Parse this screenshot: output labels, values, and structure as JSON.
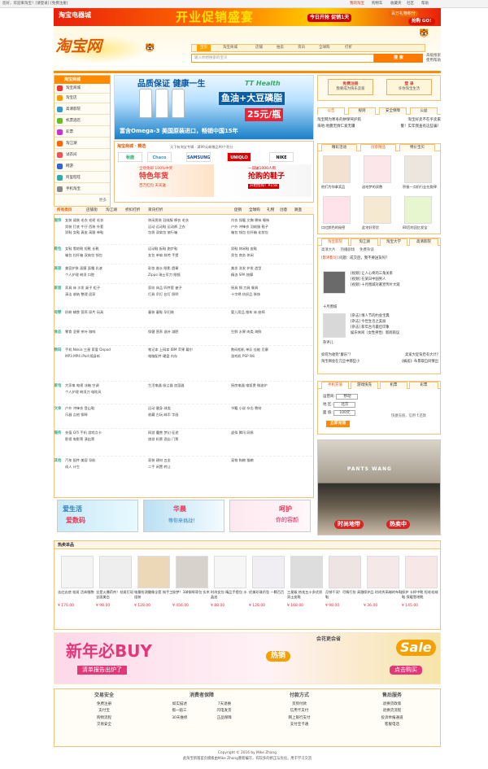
{
  "topbar": {
    "welcome": "您好，欢迎来淘宝！[请登录] [免费注册]",
    "links": [
      "我的淘宝",
      "购物车",
      "收藏夹",
      "社区",
      "帮助"
    ]
  },
  "topbanner": {
    "store": "淘宝电器城",
    "headline": "开业促销盛宴",
    "today": "今日开抢  促销1天",
    "bonus": "百万礼物积分",
    "cta": "抢购 GO!"
  },
  "logo": "淘宝网",
  "nav": {
    "tabs": [
      "宝贝",
      "淘宝商城",
      "店铺",
      "拍卖",
      "资讯",
      "全球购",
      "打折"
    ],
    "search_placeholder": "输入你想搜索的宝贝",
    "search_button": "搜 索",
    "links": [
      "高级搜索",
      "使用帮助"
    ]
  },
  "left_menu": {
    "header": "淘宝商城",
    "items": [
      "淘宝商城",
      "淘宝店",
      "高清影院",
      "机票酒店",
      "彩票",
      "淘江湖",
      "试衣间",
      "网游",
      "阿里旺旺",
      "手机淘宝"
    ],
    "more": "更多"
  },
  "banner": {
    "title": "品质保证 健康一生",
    "brand": "TT Health",
    "product": "鱼油+大豆磷脂",
    "price_label": "25元/瓶",
    "footer": "富含Omega-3 美国原装进口，畅销中国15年"
  },
  "mall": {
    "title": "淘宝商城 · 精选",
    "tip": "天下有淘宝专辑 · 满99元邮赠品99个积分",
    "brands": [
      "Chaco",
      "秋鹿",
      "SAMSUNG",
      "UNIQLO",
      "NIKE"
    ],
    "promo1": {
      "a": "全场免邮 100%中奖",
      "b": "特色年货",
      "c": "百万红包 天天送"
    },
    "promo2": {
      "a": "一双破1000人购",
      "b": "抢购的鞋子",
      "c": "开始抢购！¥158"
    }
  },
  "services": {
    "btn1": "免费注册",
    "btn1_sub": "我要成为快乐卖家",
    "btn2": "登 录",
    "btn2_sub": "许你淘宝生活"
  },
  "news_tabs": [
    "公告",
    "规则",
    "安全保障",
    "公益"
  ],
  "news": [
    "淘宝网为寒冬的拼保驾护航",
    "淘宝好卖不在乎卖家",
    "海地:地震无情仁爱无疆",
    "警！实年我查有这些骗！"
  ],
  "featured": {
    "tabs": [
      "精彩活动",
      "创意精品",
      "特价宝贝"
    ],
    "items": [
      {
        "cap": "他们为你拿奖品"
      },
      {
        "cap": "送给梦的双胞"
      },
      {
        "cap": "积极一点机行业在旋律"
      },
      {
        "cap": "口红颜色的秘密"
      },
      {
        "cap": "此宅好旁货"
      },
      {
        "cap": "80后的回忆发宝"
      }
    ]
  },
  "community": {
    "tabs": [
      "淘宝影院",
      "淘江湖",
      "淘宝大学",
      "高清影院"
    ],
    "tags": [
      "高清大片",
      "热播剧场",
      "免费杂谈"
    ],
    "hot": "[影评影论]",
    "items": [
      "问题：成交后，我不要送货吗？",
      "[视频] 让人心疼的三角关系",
      "[视频] 在某日中国男人",
      "[视频] 十月围城对著宣传片大观",
      "十月围城",
      "[杂志] 情人节的约会宝典",
      "[杂志] 今世生百之美丽",
      "[杂志] 新年台鸟最佳印象",
      "娱乐休闲（女性男性）新闻商议",
      "杂评儿"
    ],
    "questions": [
      "如何为收到\"康乐\"?",
      "卖家大促背后有大计?",
      "淘宝网会在元旦中哪些小",
      "《蜗居》布景取自同情出"
    ]
  },
  "phone": {
    "tabs": [
      "手机充值",
      "游戏快充",
      "机票",
      "彩票"
    ],
    "carrier_label": "运营商:",
    "carrier": "移动",
    "area_label": "地 区:",
    "area": "北京",
    "amount_label": "面 值:",
    "amount": "100元",
    "button": "立即充值",
    "tip": "快捷充值，信用卡还款"
  },
  "categories": {
    "header_tabs": [
      "所有类目",
      "店铺街",
      "淘江湖",
      "折扣打折",
      "资讯打折"
    ],
    "right_tabs": [
      "促销",
      "全球购",
      "礼物",
      "创意",
      "跳蚤"
    ],
    "rows": [
      {
        "label": "服饰",
        "cols": [
          "女装 裙装 毛衣 毛呢 毛衣",
          "休闲男装 羽绒服 棉衣 毛衣",
          "内衣 保暖 文胸 棉袜 睡袜",
          "男装 打底 牛仔 西装 外套",
          "运动 运动鞋 运动裤 卫衣",
          "户外 冲锋衣 羽绒服 鞋子",
          "男鞋 女鞋 真皮 高跟 单鞋",
          "包袋 双肩包 旅行箱",
          "箱包 钱包 拉杆箱 化妆包"
        ]
      },
      {
        "label": "鞋包",
        "cols": [
          "女鞋 雪地靴 短靴 长靴",
          "运动鞋 板鞋 跑步鞋",
          "男鞋 休闲鞋 皮鞋",
          "箱包 拉杆箱 双肩包 钱包",
          "女包 单肩 斜挎 手提",
          "男包 商务 休闲"
        ]
      },
      {
        "label": "美容",
        "cols": [
          "美容护肤 面膜 面霜 乳液",
          "彩妆 香水 眼影 唇膏",
          "美发 洗发 护发 造型",
          "个人护理 剃须 口腔",
          "Zippo 瑞士军刀 眼镜",
          "精油 SPA 按摩"
        ]
      },
      {
        "label": "家居",
        "cols": [
          "家具 床 沙发 桌子 柜子",
          "家纺 床品 四件套 被子",
          "厨具 锅 刀具 餐具",
          "清洁 收纳 整理 居家",
          "灯具 吊灯 台灯 照明",
          "十字绣 纺织品 装饰"
        ]
      },
      {
        "label": "母婴",
        "cols": [
          "奶粉 辅食 营养 尿片 玩具",
          "童装 童鞋 孕妇装",
          "婴儿用品 推车 床 座椅"
        ]
      },
      {
        "label": "食品",
        "cols": [
          "零食 坚果 茶叶 咖啡",
          "保健 营养 滋补 减肥",
          "生鲜 水果 肉类 海鲜"
        ]
      },
      {
        "label": "数码",
        "cols": [
          "手机 Nokia 三星 索爱 Dopod",
          "笔记本 上网本 IBM 苹果 戴尔",
          "数码相机 单反 佳能 尼康",
          "MP3 MP4 iPod 随身听",
          "电脑配件 硬盘 内存",
          "游戏机 PSP Wii"
        ]
      },
      {
        "label": "家电",
        "cols": [
          "大家电 电视 冰箱 空调",
          "生活电器 吸尘器 加湿器",
          "厨房电器 电饭煲 微波炉",
          "个人护理 剃须刀 电吹风"
        ]
      },
      {
        "label": "文体",
        "cols": [
          "户外 冲锋衣 登山鞋",
          "运动 健身 球类",
          "书籍 小说 杂志 教材",
          "乐器 吉他 钢琴",
          "收藏 古玩 邮币 字画"
        ]
      },
      {
        "label": "服务",
        "cols": [
          "充值 Q币 手机 游戏点卡",
          "网游 魔兽 梦幻 征途",
          "虚拟 腾讯 网易",
          "影视 电影票 演出票",
          "旅游 机票 酒店 门票"
        ]
      },
      {
        "label": "其他",
        "cols": [
          "汽车 配件 美容 导航",
          "家装 建材 五金",
          "宠物 狗粮 猫粮",
          "成人 计生",
          "二手 闲置 转让"
        ]
      }
    ]
  },
  "bottom_ads": [
    {
      "a": "爱生活",
      "b": "爱数码"
    },
    {
      "a": "华晨",
      "b": "等你来挑战！"
    },
    {
      "a": "呵护",
      "b": "你的容颜"
    }
  ],
  "hot": {
    "title": "热卖单品",
    "items": [
      {
        "name": "去红去痣 祛斑 活体细胞",
        "price": "¥ 176.00"
      },
      {
        "name": "全是火爆药剂！祛斑打斑全面美白",
        "price": "¥ 98.00"
      },
      {
        "name": "电量检测摄像全套 纯手工组装",
        "price": "¥ 128.00"
      },
      {
        "name": "秘梦！3球钢琴背包 实木",
        "price": "¥ 456.00"
      },
      {
        "name": "时尚女包 精品手提包 水晶皮",
        "price": "¥ 88.00"
      },
      {
        "name": "优美珍珠吊坠 一颗百百",
        "price": "¥ 128.00"
      },
      {
        "name": "三星级 热卖五十多优质 男士皮鞋",
        "price": "¥ 168.00"
      },
      {
        "name": "月销千双！尽情打扮 高跟鞋",
        "price": "¥ 98.00"
      },
      {
        "name": "保护品 时尚秀高端的布鞋",
        "price": "¥ 36.00"
      },
      {
        "name": "保护 卡杯中靴 短毛毛絨鞋 保暖雪地靴",
        "price": "¥ 145.00"
      }
    ]
  },
  "bigad": {
    "headline": "新年必BUY",
    "sub": "清单报告出炉了",
    "tag": "会花更会省",
    "hot": "热销",
    "sale": "Sale",
    "cta": "点击购买"
  },
  "footer": {
    "cols": [
      {
        "title": "交易安全",
        "rows": [
          [
            "免费注册"
          ],
          [
            "支付宝"
          ],
          [
            "购物流程"
          ],
          [
            "交易安全"
          ]
        ]
      },
      {
        "title": "消费者保障",
        "rows": [
          [
            "如实描述",
            "7天退换"
          ],
          [
            "假一赔三",
            "闪电发货"
          ],
          [
            "30天维修",
            "正品保障"
          ]
        ]
      },
      {
        "title": "付款方式",
        "rows": [
          [
            "货到付款"
          ],
          [
            "信用卡支付"
          ],
          [
            "网上银行支付"
          ],
          [
            "支付宝卡通"
          ]
        ]
      },
      {
        "title": "售后服务",
        "rows": [
          [
            "退换货政策"
          ],
          [
            "退换货流程"
          ],
          [
            "投诉举报通道"
          ],
          [
            "客服电话"
          ]
        ]
      }
    ]
  },
  "copyright": [
    "Copyright © 2016 by Mike Zhang",
    "此淘宝新版首页模板由Mike Zhang重新编写，有较多的修正与优化，用于学习交流"
  ],
  "colors": {
    "accent": "#ff8a00",
    "brand": "#e25a00",
    "link_red": "#d63c00",
    "price": "#e22233"
  }
}
